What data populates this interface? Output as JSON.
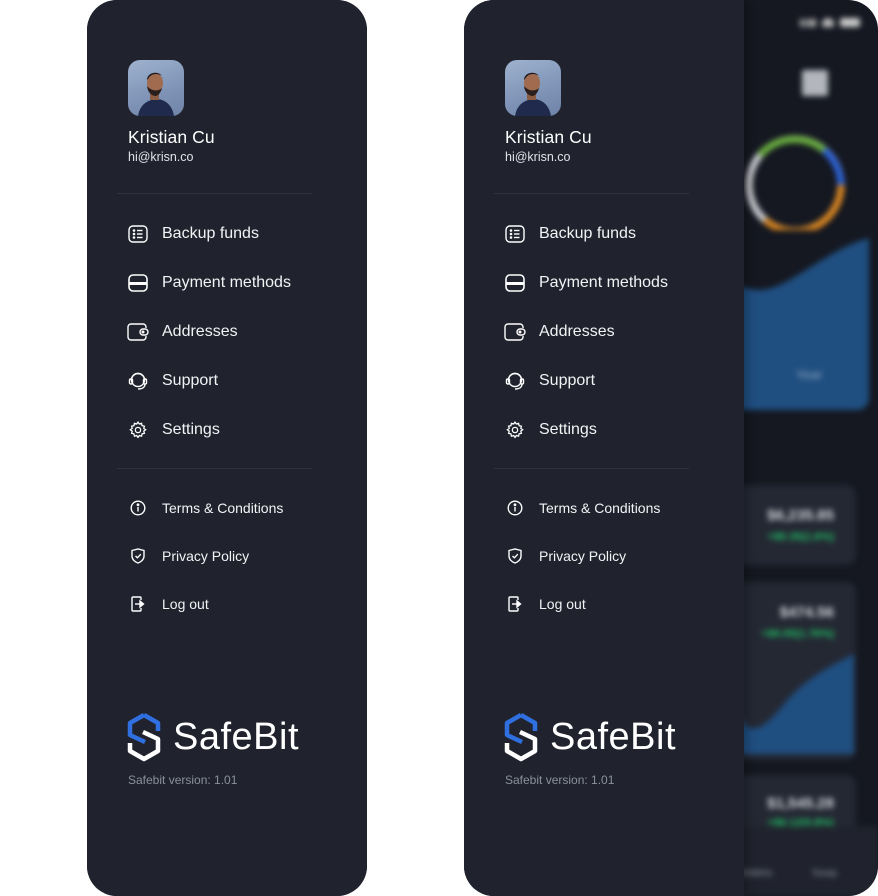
{
  "profile": {
    "name": "Kristian Cu",
    "email": "hi@krisn.co"
  },
  "menu": {
    "primary": [
      {
        "label": "Backup funds",
        "icon": "list-icon"
      },
      {
        "label": "Payment methods",
        "icon": "card-icon"
      },
      {
        "label": "Addresses",
        "icon": "wallet-icon"
      },
      {
        "label": "Support",
        "icon": "headset-icon"
      },
      {
        "label": "Settings",
        "icon": "gear-icon"
      }
    ],
    "secondary": [
      {
        "label": "Terms & Conditions",
        "icon": "info-icon"
      },
      {
        "label": "Privacy Policy",
        "icon": "shield-check-icon"
      },
      {
        "label": "Log out",
        "icon": "logout-icon"
      }
    ]
  },
  "brand": {
    "name": "SafeBit",
    "version_text": "Safebit version: 1.01",
    "colors": {
      "accent": "#2f6fe0",
      "background": "#20232d",
      "positive": "#1fbf63"
    }
  },
  "background_app": {
    "period_label": "Year",
    "coins": [
      {
        "price": "$6,235.85",
        "change": "+$0.35(1.6%)"
      },
      {
        "price": "$474.56",
        "change": "+$0.05(1.76%)"
      },
      {
        "price": "$1,545.28",
        "change": "+$0.12(0.8%)"
      }
    ],
    "tabs": [
      "Wallets",
      "Swap"
    ]
  }
}
